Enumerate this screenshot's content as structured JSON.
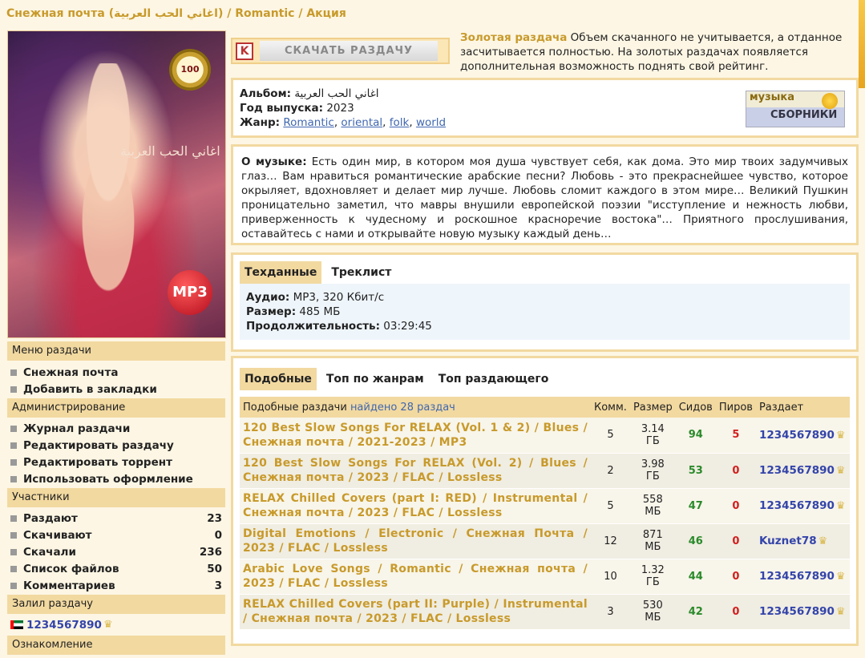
{
  "breadcrumb": {
    "title": "Снежная почта (اغاني الحب العربية)",
    "sep1": "/",
    "genre": "Romantic",
    "sep2": "/",
    "section": "Акция"
  },
  "cover": {
    "badge_text": "100",
    "arabic_text": "اغاني الحب العربية",
    "format_badge": "MP3"
  },
  "sidebar": {
    "menu_header": "Меню раздачи",
    "menu_items": [
      "Снежная почта",
      "Добавить в закладки"
    ],
    "admin_header": "Администрирование",
    "admin_items": [
      "Журнал раздачи",
      "Редактировать раздачу",
      "Редактировать торрент",
      "Использовать оформление"
    ],
    "participants_header": "Участники",
    "participants": [
      {
        "label": "Раздают",
        "value": "23"
      },
      {
        "label": "Скачивают",
        "value": "0"
      },
      {
        "label": "Скачали",
        "value": "236"
      },
      {
        "label": "Список файлов",
        "value": "50"
      },
      {
        "label": "Комментариев",
        "value": "3"
      }
    ],
    "uploader_header": "Залил раздачу",
    "uploader": "1234567890",
    "review_header": "Ознакомление"
  },
  "download": {
    "button_label": "СКАЧАТЬ РАЗДАЧУ",
    "icon_letter": "K"
  },
  "gold": {
    "label": "Золотая раздача",
    "text": "Объем скачанного не учитывается, а отданное засчитывается полностью. На золотых раздачах появляется дополнительная возможность поднять свой рейтинг."
  },
  "album": {
    "album_label": "Альбом:",
    "album_value": "اغاني الحب العربية",
    "year_label": "Год выпуска:",
    "year_value": "2023",
    "genre_label": "Жанр:",
    "genres": [
      "Romantic",
      "oriental",
      "folk",
      "world"
    ],
    "badge_top": "музыка",
    "badge_bottom": "СБОРНИКИ"
  },
  "about": {
    "label": "О музыке:",
    "text": "Есть один мир, в котором моя душа чувствует себя, как дома. Это мир твоих задумчивых глаз… Вам нравиться романтические арабские песни? Любовь - это прекраснейшее чувство, которое окрыляет, вдохновляет и делает мир лучше. Любовь сломит каждого в этом мире… Великий Пушкин проницательно заметил, что мавры внушили европейской поэзии \"исступление и нежность любви, приверженность к чудесному и роскошное красноречие востока\"… Приятного прослушивания, оставайтесь с нами и открывайте новую музыку каждый день…"
  },
  "tech": {
    "tabs": [
      "Техданные",
      "Треклист"
    ],
    "audio_label": "Аудио:",
    "audio_value": "MP3, 320 Кбит/с",
    "size_label": "Размер:",
    "size_value": "485 МБ",
    "duration_label": "Продолжительность:",
    "duration_value": "03:29:45"
  },
  "similar": {
    "tabs": [
      "Подобные",
      "Топ по жанрам",
      "Топ раздающего"
    ],
    "header_label": "Подобные раздачи",
    "found": "найдено 28 раздач",
    "columns": [
      "Комм.",
      "Размер",
      "Сидов",
      "Пиров",
      "Раздает"
    ],
    "rows": [
      {
        "title": "120 Best Slow Songs For RELAX (Vol. 1 & 2) / Blues / Снежная почта / 2021-2023 / MP3",
        "comments": "5",
        "size": "3.14 ГБ",
        "seeds": "94",
        "peers": "5",
        "uploader": "1234567890"
      },
      {
        "title": "120 Best Slow Songs For RELAX (Vol. 2) / Blues / Снежная почта / 2023 / FLAC / Lossless",
        "comments": "2",
        "size": "3.98 ГБ",
        "seeds": "53",
        "peers": "0",
        "uploader": "1234567890"
      },
      {
        "title": "RELAX Chilled Covers (part I: RED) / Instrumental / Снежная почта / 2023 / FLAC / Lossless",
        "comments": "5",
        "size": "558 МБ",
        "seeds": "47",
        "peers": "0",
        "uploader": "1234567890"
      },
      {
        "title": "Digital Emotions / Electronic / Снежная Почта / 2023 / FLAC / Lossless",
        "comments": "12",
        "size": "871 МБ",
        "seeds": "46",
        "peers": "0",
        "uploader": "Kuznet78"
      },
      {
        "title": "Arabic Love Songs / Romantic / Снежная почта / 2023 / FLAC / Lossless",
        "comments": "10",
        "size": "1.32 ГБ",
        "seeds": "44",
        "peers": "0",
        "uploader": "1234567890"
      },
      {
        "title": "RELAX Chilled Covers (part II: Purple) / Instrumental / Снежная почта / 2023 / FLAC / Lossless",
        "comments": "3",
        "size": "530 МБ",
        "seeds": "42",
        "peers": "0",
        "uploader": "1234567890"
      }
    ]
  },
  "colors": {
    "accent_gold": "#c89a2b",
    "panel_border": "#f2d9a0",
    "link_blue": "#3f67b0",
    "seed_green": "#2a8a2a",
    "peer_red": "#d02020"
  }
}
